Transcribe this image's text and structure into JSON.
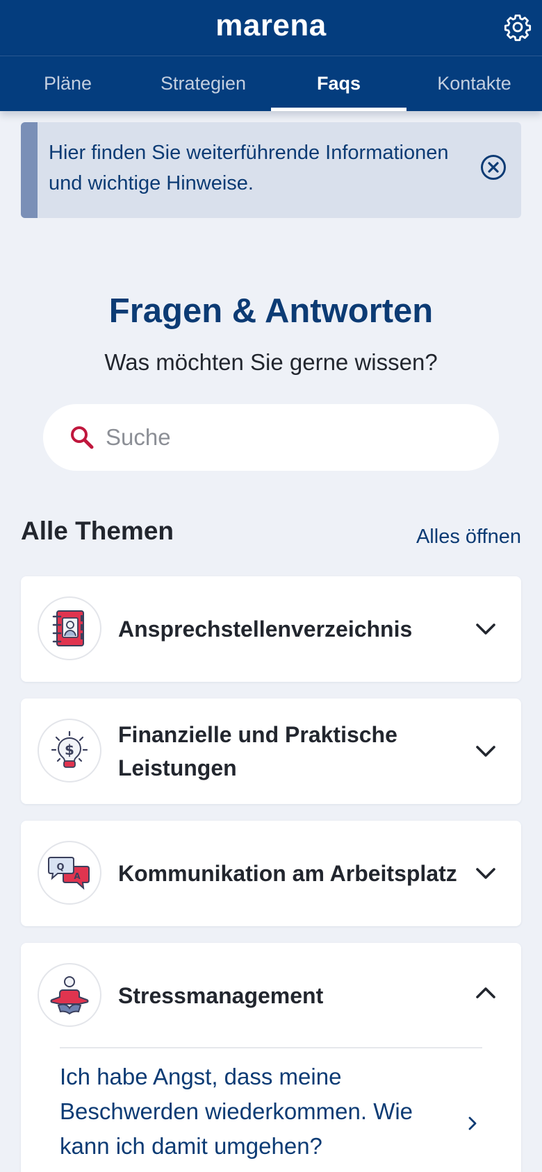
{
  "header": {
    "brand": "marena",
    "settings_icon": "gear-icon"
  },
  "tabs": [
    {
      "label": "Pläne",
      "active": false
    },
    {
      "label": "Strategien",
      "active": false
    },
    {
      "label": "Faqs",
      "active": true
    },
    {
      "label": "Kontakte",
      "active": false
    }
  ],
  "banner": {
    "text": "Hier finden Sie weiterführende Informationen und wichtige Hinweise.",
    "close_icon": "close-circle-icon"
  },
  "main": {
    "title": "Fragen & Antworten",
    "subtitle": "Was möchten Sie gerne wissen?",
    "search": {
      "placeholder": "Suche",
      "value": ""
    }
  },
  "topics": {
    "heading": "Alle Themen",
    "open_all": "Alles öffnen",
    "items": [
      {
        "title": "Ansprechstellenverzeichnis",
        "icon": "address-book-icon",
        "expanded": false
      },
      {
        "title": "Finanzielle und Praktische Leistungen",
        "icon": "lightbulb-dollar-icon",
        "expanded": false
      },
      {
        "title": "Kommunikation am Arbeitsplatz",
        "icon": "qa-speech-bubbles-icon",
        "expanded": false
      },
      {
        "title": "Stressmanagement",
        "icon": "meditation-icon",
        "expanded": true,
        "questions": [
          "Ich habe Angst, dass meine Beschwerden wiederkommen. Wie kann ich damit umgehen?"
        ]
      }
    ]
  },
  "colors": {
    "primary": "#043d7e",
    "background": "#eef1f7",
    "accent_red": "#c0173d",
    "banner_bg": "#d9e0ec"
  }
}
